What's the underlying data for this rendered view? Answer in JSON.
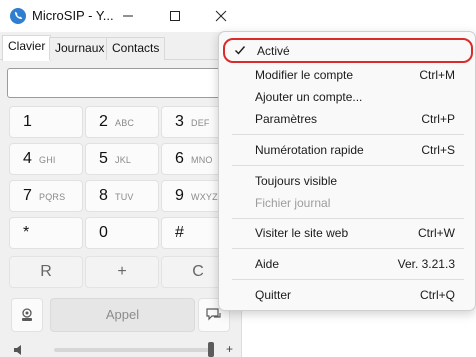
{
  "window": {
    "title": "MicroSIP - Y...",
    "icon": "microsip-phone-icon"
  },
  "tabs": [
    {
      "label": "Clavier",
      "active": true
    },
    {
      "label": "Journaux",
      "active": false
    },
    {
      "label": "Contacts",
      "active": false
    }
  ],
  "dial_input": {
    "value": "",
    "placeholder": ""
  },
  "keypad": [
    {
      "digit": "1",
      "letters": ""
    },
    {
      "digit": "2",
      "letters": "ABC"
    },
    {
      "digit": "3",
      "letters": "DEF"
    },
    {
      "digit": "4",
      "letters": "GHI"
    },
    {
      "digit": "5",
      "letters": "JKL"
    },
    {
      "digit": "6",
      "letters": "MNO"
    },
    {
      "digit": "7",
      "letters": "PQRS"
    },
    {
      "digit": "8",
      "letters": "TUV"
    },
    {
      "digit": "9",
      "letters": "WXYZ"
    },
    {
      "digit": "*",
      "letters": ""
    },
    {
      "digit": "0",
      "letters": ""
    },
    {
      "digit": "#",
      "letters": ""
    }
  ],
  "modifiers": [
    "R",
    "+",
    "C"
  ],
  "actions": {
    "call_label": "Appel",
    "left_icon": "voicemail-icon",
    "right_icon": "message-icon"
  },
  "volume": {
    "icon": "speaker-icon",
    "plus": "+",
    "level": 0.98
  },
  "menu": {
    "items": [
      {
        "label": "Activé",
        "shortcut": "",
        "checked": true,
        "disabled": false,
        "highlighted": true
      },
      {
        "label": "Modifier le compte",
        "shortcut": "Ctrl+M",
        "checked": false,
        "disabled": false
      },
      {
        "label": "Ajouter un compte...",
        "shortcut": "",
        "checked": false,
        "disabled": false
      },
      {
        "label": "Paramètres",
        "shortcut": "Ctrl+P",
        "checked": false,
        "disabled": false
      },
      {
        "label": "Numérotation rapide",
        "shortcut": "Ctrl+S",
        "checked": false,
        "disabled": false
      },
      {
        "label": "Toujours visible",
        "shortcut": "",
        "checked": false,
        "disabled": false
      },
      {
        "label": "Fichier journal",
        "shortcut": "",
        "checked": false,
        "disabled": true
      },
      {
        "label": "Visiter le site web",
        "shortcut": "Ctrl+W",
        "checked": false,
        "disabled": false
      },
      {
        "label": "Aide",
        "shortcut": "Ver. 3.21.3",
        "checked": false,
        "disabled": false
      },
      {
        "label": "Quitter",
        "shortcut": "Ctrl+Q",
        "checked": false,
        "disabled": false
      }
    ],
    "highlight_color": "#d92b2b"
  }
}
